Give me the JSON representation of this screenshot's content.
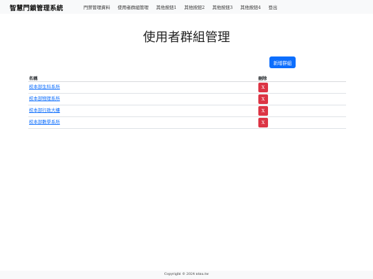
{
  "navbar": {
    "brand": "智慧門鎖管理系統",
    "links": [
      "門禁管理資料",
      "使用者群組管理",
      "其他按鈕1",
      "其他按鈕2",
      "其他按鈕3",
      "其他按鈕4",
      "登出"
    ]
  },
  "page": {
    "title": "使用者群組管理"
  },
  "toolbar": {
    "add_label": "新增群組"
  },
  "table": {
    "headers": {
      "name": "名稱",
      "delete": "刪除"
    },
    "rows": [
      {
        "name": "校本部生科系所",
        "delete_label": "X"
      },
      {
        "name": "校本部物理系所",
        "delete_label": "X"
      },
      {
        "name": "校本部行政大樓",
        "delete_label": "X"
      },
      {
        "name": "校本部數學系所",
        "delete_label": "X"
      }
    ]
  },
  "footer": {
    "copyright": "Copyright © 2024 ntnu.tw"
  },
  "colors": {
    "primary": "#0d6efd",
    "danger": "#dc3545",
    "navbar_bg": "#f8f9fa"
  }
}
